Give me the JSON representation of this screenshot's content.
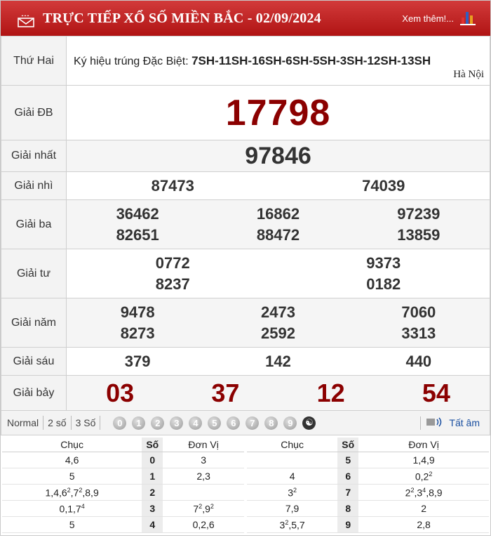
{
  "header": {
    "title": "TRỰC TIẾP XỔ SỐ MIỀN BẮC - 02/09/2024",
    "more_link": "Xem thêm!..."
  },
  "info": {
    "day": "Thứ Hai",
    "symbol_label": "Ký hiệu trúng Đặc Biệt: ",
    "symbol_value": "7SH-11SH-16SH-6SH-5SH-3SH-12SH-13SH",
    "region": "Hà Nội"
  },
  "prizes": {
    "db": {
      "label": "Giải ĐB",
      "numbers": [
        "17798"
      ]
    },
    "nhat": {
      "label": "Giải nhất",
      "numbers": [
        "97846"
      ]
    },
    "nhi": {
      "label": "Giải nhì",
      "numbers": [
        "87473",
        "74039"
      ]
    },
    "ba": {
      "label": "Giải ba",
      "numbers": [
        "36462",
        "16862",
        "97239",
        "82651",
        "88472",
        "13859"
      ]
    },
    "tu": {
      "label": "Giải tư",
      "numbers": [
        "0772",
        "9373",
        "8237",
        "0182"
      ]
    },
    "nam": {
      "label": "Giải năm",
      "numbers": [
        "9478",
        "2473",
        "7060",
        "8273",
        "2592",
        "3313"
      ]
    },
    "sau": {
      "label": "Giải sáu",
      "numbers": [
        "379",
        "142",
        "440"
      ]
    },
    "bay": {
      "label": "Giải bảy",
      "numbers": [
        "03",
        "37",
        "12",
        "54"
      ]
    }
  },
  "toolbar": {
    "options": [
      "Normal",
      "2 số",
      "3 Số"
    ],
    "digits": [
      "0",
      "1",
      "2",
      "3",
      "4",
      "5",
      "6",
      "7",
      "8",
      "9"
    ],
    "tat_am": "Tất âm"
  },
  "loto": {
    "headers": {
      "chuc": "Chục",
      "so": "Số",
      "donvi": "Đơn Vị"
    },
    "left": [
      {
        "chuc": "4,6",
        "so": "0",
        "donvi": "3"
      },
      {
        "chuc": "5",
        "so": "1",
        "donvi": "2,3"
      },
      {
        "chuc": "1,4,6<sup>2</sup>,7<sup>2</sup>,8,9",
        "so": "2",
        "donvi": ""
      },
      {
        "chuc": "0,1,7<sup>4</sup>",
        "so": "3",
        "donvi": "7<sup>2</sup>,9<sup>2</sup>"
      },
      {
        "chuc": "5",
        "so": "4",
        "donvi": "0,2,6"
      }
    ],
    "right": [
      {
        "chuc": "",
        "so": "5",
        "donvi": "1,4,9"
      },
      {
        "chuc": "4",
        "so": "6",
        "donvi": "0,2<sup>2</sup>"
      },
      {
        "chuc": "3<sup>2</sup>",
        "so": "7",
        "donvi": "2<sup>2</sup>,3<sup>4</sup>,8,9"
      },
      {
        "chuc": "7,9",
        "so": "8",
        "donvi": "2"
      },
      {
        "chuc": "3<sup>2</sup>,5,7",
        "so": "9",
        "donvi": "2,8"
      }
    ]
  }
}
